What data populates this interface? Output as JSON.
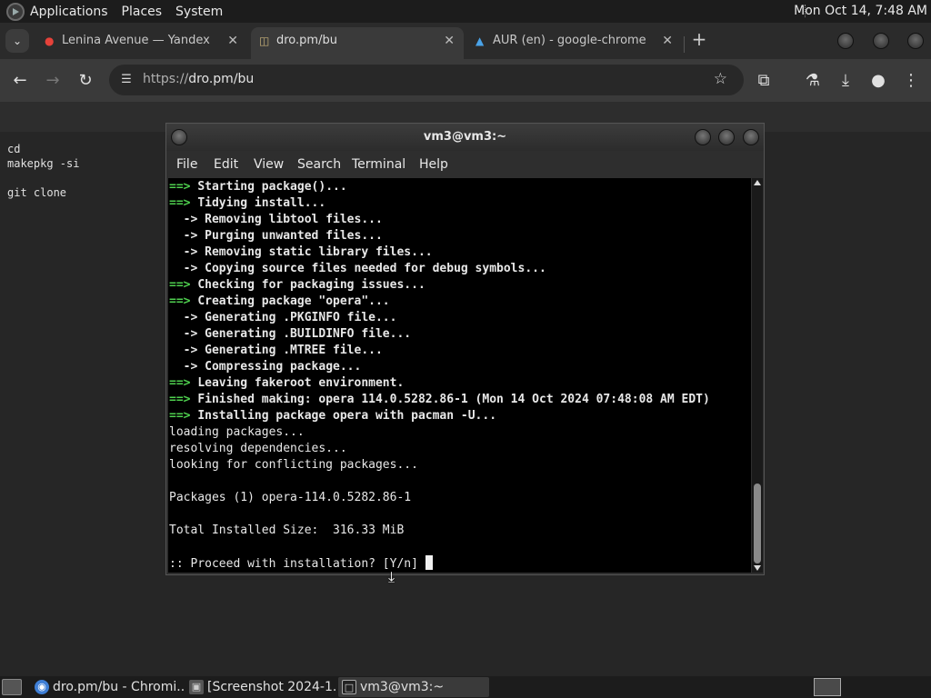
{
  "top_panel": {
    "menus": [
      "Applications",
      "Places",
      "System"
    ],
    "clock": "Mon Oct 14,  7:48 AM"
  },
  "browser": {
    "tabs": [
      {
        "title": "Lenina Avenue — Yandex Ma",
        "icon": "map-pin-icon",
        "active": false
      },
      {
        "title": "dro.pm/bu",
        "icon": "folder-icon",
        "active": true
      },
      {
        "title": "AUR (en) - google-chrome-d",
        "icon": "arch-logo-icon",
        "active": false
      }
    ],
    "url_scheme": "https://",
    "url_host": "dro.pm/bu"
  },
  "page": {
    "text": "cd\nmakepkg -si\n\ngit clone"
  },
  "terminal": {
    "title": "vm3@vm3:~",
    "menu": [
      "File",
      "Edit",
      "View",
      "Search",
      "Terminal",
      "Help"
    ],
    "lines": [
      {
        "prefix": "==> ",
        "kind": "g",
        "text": "Starting package()..."
      },
      {
        "prefix": "==> ",
        "kind": "g",
        "text": "Tidying install..."
      },
      {
        "prefix": "  -> ",
        "kind": "b",
        "text": "Removing libtool files..."
      },
      {
        "prefix": "  -> ",
        "kind": "b",
        "text": "Purging unwanted files..."
      },
      {
        "prefix": "  -> ",
        "kind": "b",
        "text": "Removing static library files..."
      },
      {
        "prefix": "  -> ",
        "kind": "b",
        "text": "Copying source files needed for debug symbols..."
      },
      {
        "prefix": "==> ",
        "kind": "g",
        "text": "Checking for packaging issues..."
      },
      {
        "prefix": "==> ",
        "kind": "g",
        "text": "Creating package \"opera\"..."
      },
      {
        "prefix": "  -> ",
        "kind": "b",
        "text": "Generating .PKGINFO file..."
      },
      {
        "prefix": "  -> ",
        "kind": "b",
        "text": "Generating .BUILDINFO file..."
      },
      {
        "prefix": "  -> ",
        "kind": "b",
        "text": "Generating .MTREE file..."
      },
      {
        "prefix": "  -> ",
        "kind": "b",
        "text": "Compressing package..."
      },
      {
        "prefix": "==> ",
        "kind": "g",
        "text": "Leaving fakeroot environment."
      },
      {
        "prefix": "==> ",
        "kind": "g",
        "text": "Finished making: opera 114.0.5282.86-1 (Mon 14 Oct 2024 07:48:08 AM EDT)"
      },
      {
        "prefix": "==> ",
        "kind": "g",
        "text": "Installing package opera with pacman -U..."
      },
      {
        "prefix": "",
        "kind": "n",
        "text": "loading packages..."
      },
      {
        "prefix": "",
        "kind": "n",
        "text": "resolving dependencies..."
      },
      {
        "prefix": "",
        "kind": "n",
        "text": "looking for conflicting packages..."
      },
      {
        "prefix": "",
        "kind": "n",
        "text": ""
      },
      {
        "prefix": "",
        "kind": "n",
        "text": "Packages (1) opera-114.0.5282.86-1"
      },
      {
        "prefix": "",
        "kind": "n",
        "text": ""
      },
      {
        "prefix": "",
        "kind": "n",
        "text": "Total Installed Size:  316.33 MiB"
      },
      {
        "prefix": "",
        "kind": "n",
        "text": ""
      },
      {
        "prefix": "",
        "kind": "n",
        "text": ":: Proceed with installation? [Y/n] "
      }
    ]
  },
  "taskbar": {
    "tasks": [
      {
        "label": "dro.pm/bu - Chromi...",
        "icon": "chromium-icon",
        "active": false
      },
      {
        "label": "[Screenshot 2024-1...",
        "icon": "screenshot-icon",
        "active": false
      },
      {
        "label": "vm3@vm3:~",
        "icon": "terminal-icon",
        "active": true
      }
    ]
  },
  "colors": {
    "prompt_arrow": "#4fd14f",
    "terminal_bg": "#000000",
    "panel_bg": "#1c1c1c"
  }
}
